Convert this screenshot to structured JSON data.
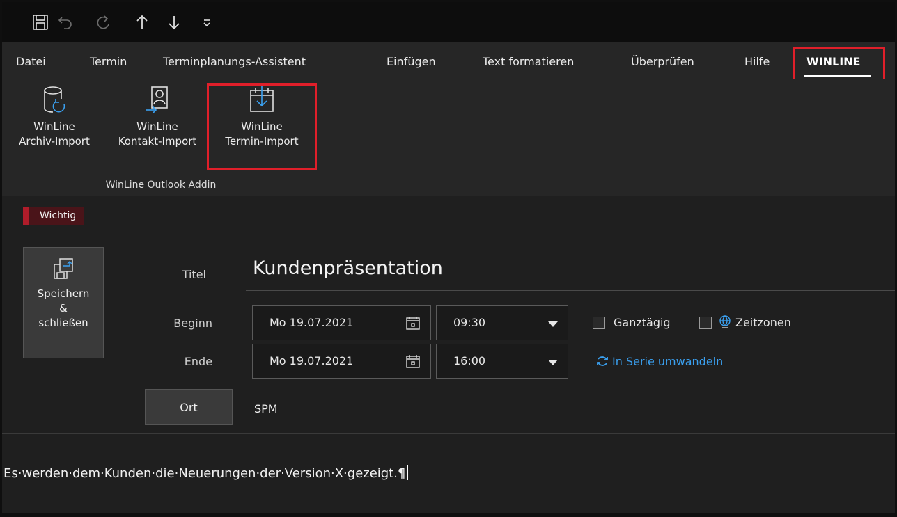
{
  "quick_access": {
    "icons": [
      "save-icon",
      "undo-icon",
      "redo-icon",
      "arrow-up-icon",
      "arrow-down-icon",
      "customize-toolbar-icon"
    ]
  },
  "tabs": [
    {
      "label": "Datei"
    },
    {
      "label": "Termin"
    },
    {
      "label": "Terminplanungs-Assistent"
    },
    {
      "label": "Einfügen"
    },
    {
      "label": "Text formatieren"
    },
    {
      "label": "Überprüfen"
    },
    {
      "label": "Hilfe"
    },
    {
      "label": "WINLINE",
      "active": true
    }
  ],
  "ribbon": {
    "buttons": [
      {
        "line1": "WinLine",
        "line2": "Archiv-Import",
        "icon": "archive-import-icon"
      },
      {
        "line1": "WinLine",
        "line2": "Kontakt-Import",
        "icon": "contact-import-icon"
      },
      {
        "line1": "WinLine",
        "line2": "Termin-Import",
        "icon": "calendar-import-icon"
      }
    ],
    "group_label": "WinLine Outlook Addin"
  },
  "form": {
    "badge": "Wichtig",
    "save_button": {
      "line1": "Speichern",
      "line2": "&",
      "line3": "schließen"
    },
    "title_label": "Titel",
    "title_value": "Kundenpräsentation",
    "start_label": "Beginn",
    "start_date": "Mo 19.07.2021",
    "start_time": "09:30",
    "end_label": "Ende",
    "end_date": "Mo 19.07.2021",
    "end_time": "16:00",
    "all_day_label": "Ganztägig",
    "time_zones_label": "Zeitzonen",
    "series_link": "In Serie umwandeln",
    "location_button": "Ort",
    "location_value": "SPM"
  },
  "body": {
    "text": "Es·werden·dem·Kunden·die·Neuerungen·der·Version·X·gezeigt.¶"
  },
  "colors": {
    "highlight": "#e01f2a",
    "link": "#3aa0f0",
    "badge_bg": "#4a1419"
  }
}
